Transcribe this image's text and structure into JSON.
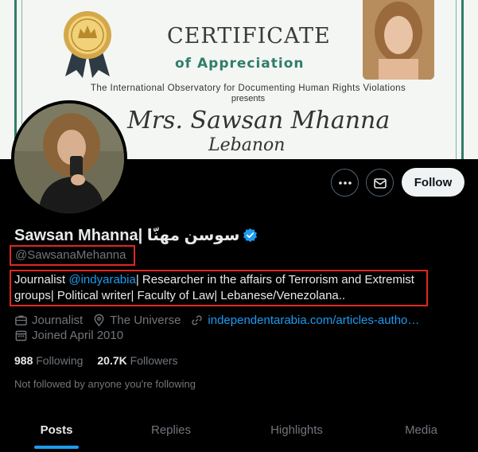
{
  "banner": {
    "cert_title": "CERTIFICATE",
    "cert_subtitle": "of Appreciation",
    "cert_org": "The International Observatory for Documenting Human Rights Violations",
    "cert_presents": "presents",
    "cert_name": "Mrs. Sawsan Mhanna",
    "cert_country": "Lebanon"
  },
  "actions": {
    "more_icon": "more-icon",
    "message_icon": "envelope-icon",
    "follow_label": "Follow"
  },
  "profile": {
    "display_name": "Sawsan Mhanna| سوسن مهنّا",
    "handle": "@SawsanaMehanna",
    "bio_prefix": "Journalist ",
    "bio_mention": "@indyarabia",
    "bio_suffix": "| Researcher in the affairs of Terrorism and Extremist groups| Political writer| Faculty of Law| Lebanese/Venezolana..",
    "category": "Journalist",
    "location": "The Universe",
    "website": "independentarabia.com/articles-autho…",
    "joined": "Joined April 2010",
    "following_count": "988",
    "following_label": "Following",
    "followers_count": "20.7K",
    "followers_label": "Followers",
    "not_followed": "Not followed by anyone you're following"
  },
  "tabs": [
    {
      "label": "Posts",
      "active": true
    },
    {
      "label": "Replies",
      "active": false
    },
    {
      "label": "Highlights",
      "active": false
    },
    {
      "label": "Media",
      "active": false
    }
  ],
  "colors": {
    "accent": "#1d9bf0",
    "highlight_box": "#e0271e",
    "background": "#000000"
  }
}
